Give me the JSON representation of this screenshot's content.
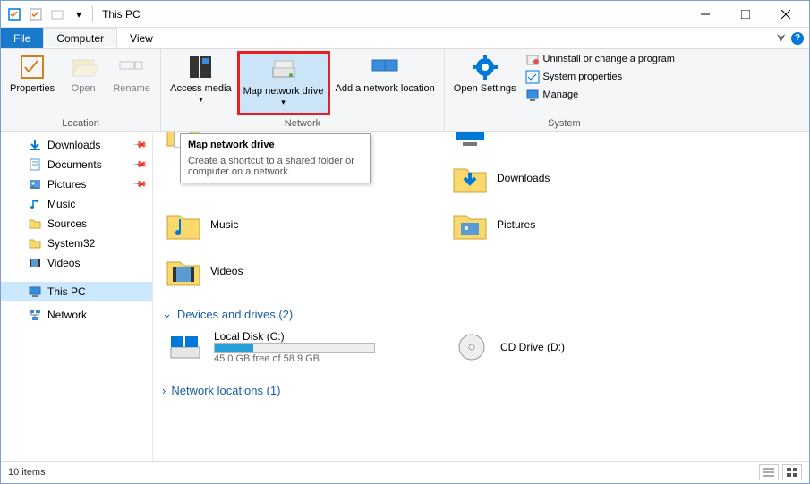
{
  "title": "This PC",
  "tabs": {
    "file": "File",
    "computer": "Computer",
    "view": "View"
  },
  "ribbon": {
    "location": {
      "title": "Location",
      "properties": "Properties",
      "open": "Open",
      "rename": "Rename"
    },
    "network": {
      "title": "Network",
      "access_media": "Access media",
      "map_drive": "Map network drive",
      "add_location": "Add a network location"
    },
    "system": {
      "title": "System",
      "open_settings": "Open Settings",
      "uninstall": "Uninstall or change a program",
      "properties": "System properties",
      "manage": "Manage"
    }
  },
  "tooltip": {
    "title": "Map network drive",
    "body": "Create a shortcut to a shared folder or computer on a network."
  },
  "nav": {
    "downloads": "Downloads",
    "documents": "Documents",
    "pictures": "Pictures",
    "music": "Music",
    "sources": "Sources",
    "system32": "System32",
    "videos": "Videos",
    "this_pc": "This PC",
    "network": "Network"
  },
  "folders": {
    "downloads": "Downloads",
    "music": "Music",
    "pictures": "Pictures",
    "videos": "Videos"
  },
  "groups": {
    "devices": "Devices and drives (2)",
    "networklocs": "Network locations (1)"
  },
  "drives": {
    "local": {
      "name": "Local Disk (C:)",
      "sub": "45.0 GB free of 58.9 GB",
      "fill_pct": 24
    },
    "cd": {
      "name": "CD Drive (D:)"
    }
  },
  "status": {
    "count": "10 items"
  }
}
